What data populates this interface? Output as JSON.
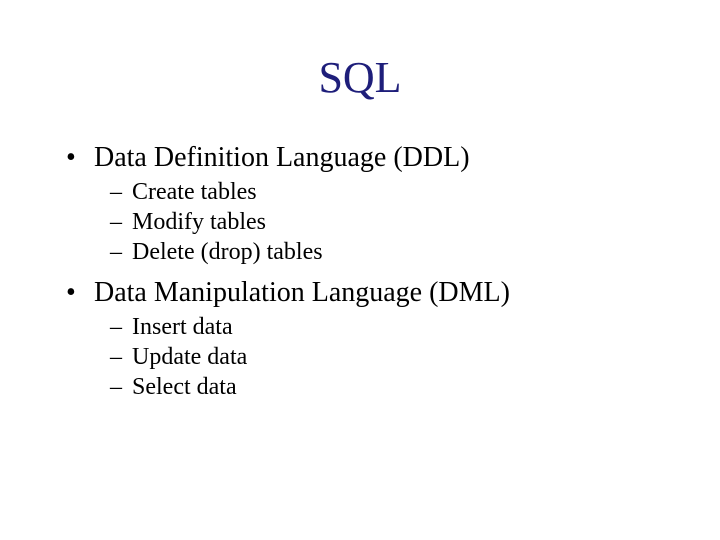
{
  "title": "SQL",
  "sections": [
    {
      "heading": "Data Definition Language (DDL)",
      "items": [
        "Create tables",
        "Modify tables",
        "Delete (drop) tables"
      ]
    },
    {
      "heading": "Data Manipulation Language (DML)",
      "items": [
        "Insert data",
        "Update data",
        "Select data"
      ]
    }
  ],
  "marks": {
    "l1": "•",
    "l2": "–"
  }
}
